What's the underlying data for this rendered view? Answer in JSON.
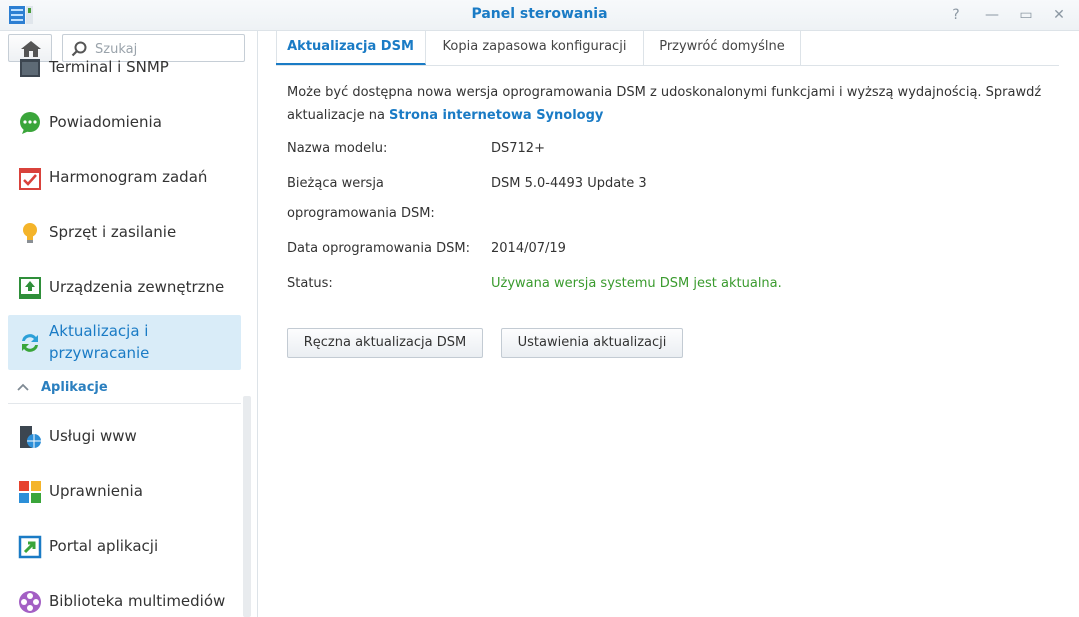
{
  "window": {
    "title": "Panel sterowania",
    "controls": {
      "help": "?",
      "minimize": "—",
      "maximize": "▭",
      "close": "✕"
    }
  },
  "sidebar": {
    "search_placeholder": "Szukaj",
    "items": [
      {
        "label": "Terminal i SNMP",
        "icon": "terminal-icon"
      },
      {
        "label": "Powiadomienia",
        "icon": "chat-bubble-icon"
      },
      {
        "label": "Harmonogram zadań",
        "icon": "calendar-check-icon"
      },
      {
        "label": "Sprzęt i zasilanie",
        "icon": "lightbulb-icon"
      },
      {
        "label": "Urządzenia zewnętrzne",
        "icon": "external-device-icon"
      },
      {
        "label": "Aktualizacja i przywracanie",
        "icon": "refresh-arrows-icon"
      }
    ],
    "section": "Aplikacje",
    "app_items": [
      {
        "label": "Usługi www",
        "icon": "web-services-icon"
      },
      {
        "label": "Uprawnienia",
        "icon": "privileges-icon"
      },
      {
        "label": "Portal aplikacji",
        "icon": "application-portal-icon"
      },
      {
        "label": "Biblioteka multimediów",
        "icon": "media-library-icon"
      }
    ]
  },
  "tabs": [
    {
      "label": "Aktualizacja DSM",
      "active": true
    },
    {
      "label": "Kopia zapasowa konfiguracji",
      "active": false
    },
    {
      "label": "Przywróć domyślne",
      "active": false
    }
  ],
  "content": {
    "description": "Może być dostępna nowa wersja oprogramowania DSM z udoskonalonymi funkcjami i wyższą wydajnością. Sprawdź aktualizacje na",
    "link": "Strona internetowa Synology",
    "rows": [
      {
        "label": "Nazwa modelu:",
        "value": "DS712+"
      },
      {
        "label": "Bieżąca wersja",
        "label2": "oprogramowania DSM:",
        "value": "DSM 5.0-4493 Update 3"
      },
      {
        "label": "Data oprogramowania DSM:",
        "value": "2014/07/19"
      },
      {
        "label": "Status:",
        "value": "Używana wersja systemu DSM jest aktualna."
      }
    ],
    "buttons": {
      "manual": "Ręczna aktualizacja DSM",
      "settings": "Ustawienia aktualizacji"
    }
  },
  "colors": {
    "accent": "#1a7bc5",
    "status_ok": "#3a9b2e",
    "active_bg": "#d9ecf8"
  }
}
